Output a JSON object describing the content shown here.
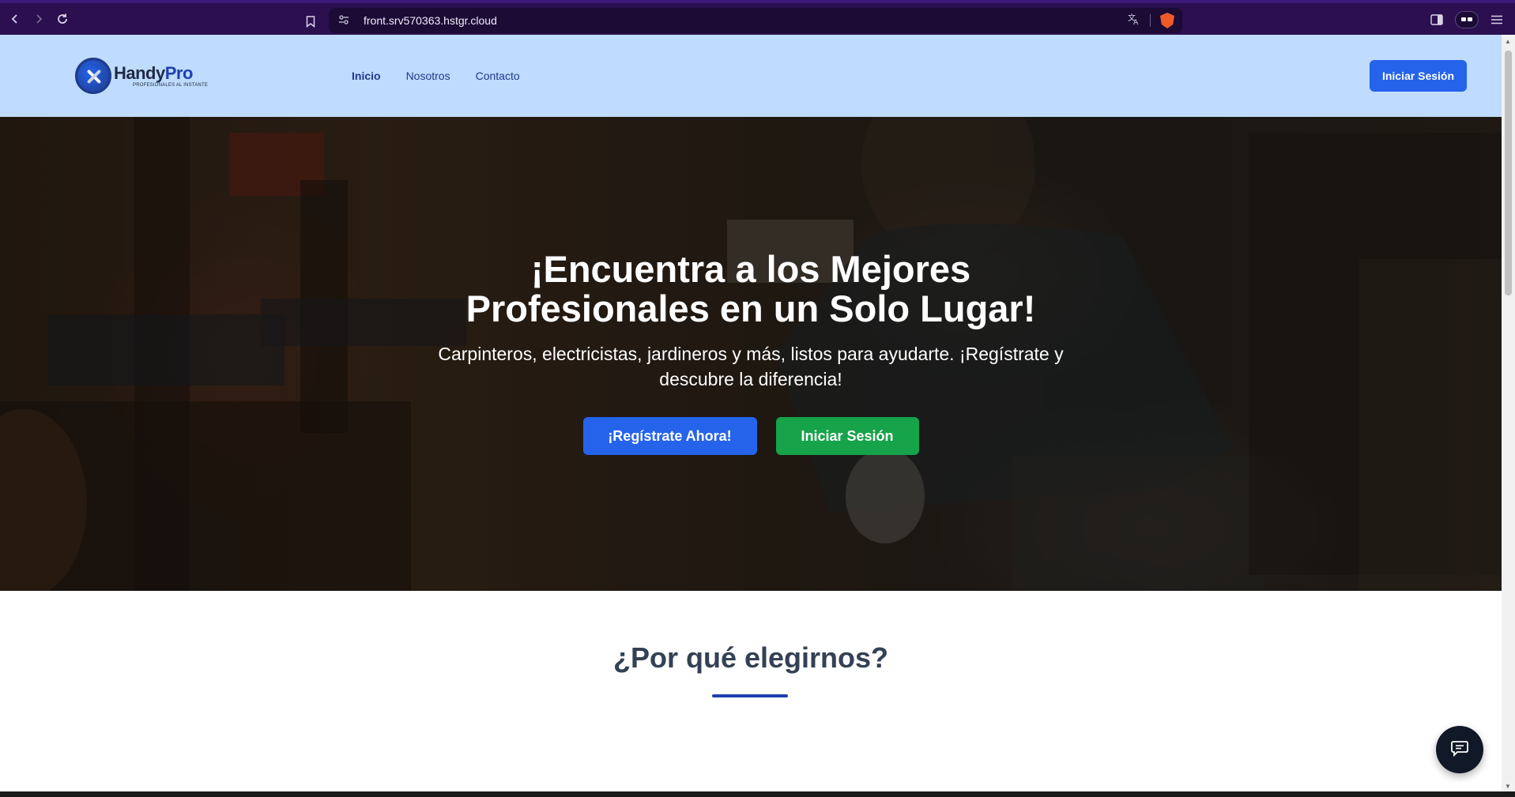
{
  "browser": {
    "url": "front.srv570363.hstgr.cloud"
  },
  "header": {
    "logo_name_part1": "Handy",
    "logo_name_part2": "Pro",
    "logo_tagline": "PROFESIONALES AL INSTANTE",
    "nav": [
      {
        "label": "Inicio",
        "active": true
      },
      {
        "label": "Nosotros",
        "active": false
      },
      {
        "label": "Contacto",
        "active": false
      }
    ],
    "login_label": "Iniciar Sesión"
  },
  "hero": {
    "title_line1": "¡Encuentra a los Mejores",
    "title_line2": "Profesionales en un Solo Lugar!",
    "subtitle": "Carpinteros, electricistas, jardineros y más, listos para ayudarte. ¡Regístrate y descubre la diferencia!",
    "register_label": "¡Regístrate Ahora!",
    "login_label": "Iniciar Sesión"
  },
  "why": {
    "title": "¿Por qué elegirnos?"
  },
  "icons": {
    "back": "back-arrow-icon",
    "forward": "forward-arrow-icon",
    "reload": "reload-icon",
    "bookmark": "bookmark-icon",
    "site_info": "site-settings-icon",
    "translate": "translate-icon",
    "brave": "brave-shield-icon",
    "sidebar": "sidebar-icon",
    "wallet": "wallet-icon",
    "menu": "menu-icon",
    "chat": "chat-icon"
  },
  "colors": {
    "header_bg": "#bfdbfe",
    "primary": "#2563eb",
    "success": "#16a34a",
    "nav_text": "#1e3a8a",
    "browser_chrome": "#2b0f4f"
  }
}
